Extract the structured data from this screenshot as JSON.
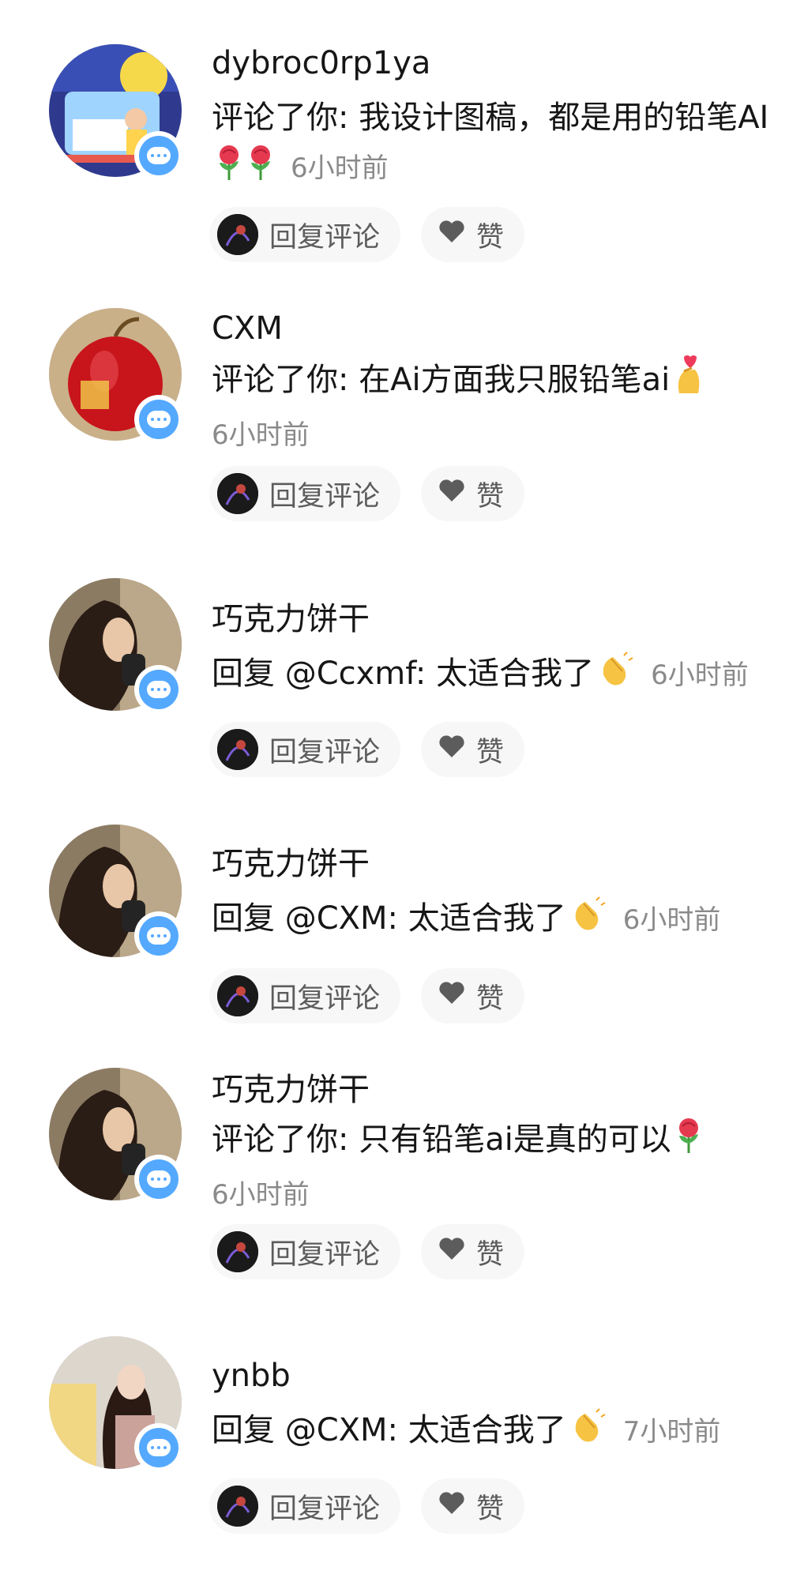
{
  "comments": [
    {
      "username": "dybroc0rp1ya",
      "text": "评论了你: 我设计图稿，都是用的铅笔AI",
      "emojis": [
        "rose",
        "rose"
      ],
      "time": "6小时前",
      "reply_label": "回复评论",
      "like_label": "赞"
    },
    {
      "username": "CXM",
      "text": "评论了你: 在Ai方面我只服铅笔ai",
      "emojis": [
        "finger-heart"
      ],
      "time": "6小时前",
      "reply_label": "回复评论",
      "like_label": "赞"
    },
    {
      "username": "巧克力饼干",
      "text": "回复 @Ccxmf: 太适合我了",
      "emojis": [
        "clapping-hands"
      ],
      "time": "6小时前",
      "reply_label": "回复评论",
      "like_label": "赞"
    },
    {
      "username": "巧克力饼干",
      "text": "回复 @CXM: 太适合我了",
      "emojis": [
        "clapping-hands"
      ],
      "time": "6小时前",
      "reply_label": "回复评论",
      "like_label": "赞"
    },
    {
      "username": "巧克力饼干",
      "text": "评论了你: 只有铅笔ai是真的可以",
      "emojis": [
        "rose"
      ],
      "time": "6小时前",
      "reply_label": "回复评论",
      "like_label": "赞"
    },
    {
      "username": "ynbb",
      "text": "回复 @CXM: 太适合我了",
      "emojis": [
        "clapping-hands"
      ],
      "time": "7小时前",
      "reply_label": "回复评论",
      "like_label": "赞"
    }
  ],
  "colors": {
    "badge": "#54a9ff",
    "time": "#8a8a8a",
    "pill_bg": "#f7f7f7",
    "heart": "#5c5c5c"
  }
}
